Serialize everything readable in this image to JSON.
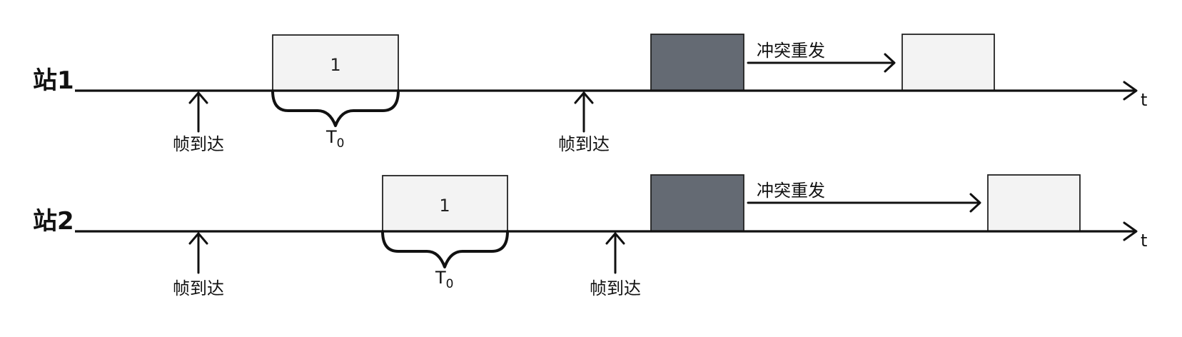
{
  "time_label": "t",
  "arrival_label": "帧到达",
  "retransmit_label": "冲突重发",
  "duration_label": {
    "main": "T",
    "sub": "0"
  },
  "stations": [
    {
      "name": "站1",
      "frame_number": "1"
    },
    {
      "name": "站2",
      "frame_number": "1"
    }
  ],
  "colors": {
    "line": "#111111",
    "frame_fill": "#f3f3f3",
    "collision_fill": "#646a73"
  }
}
